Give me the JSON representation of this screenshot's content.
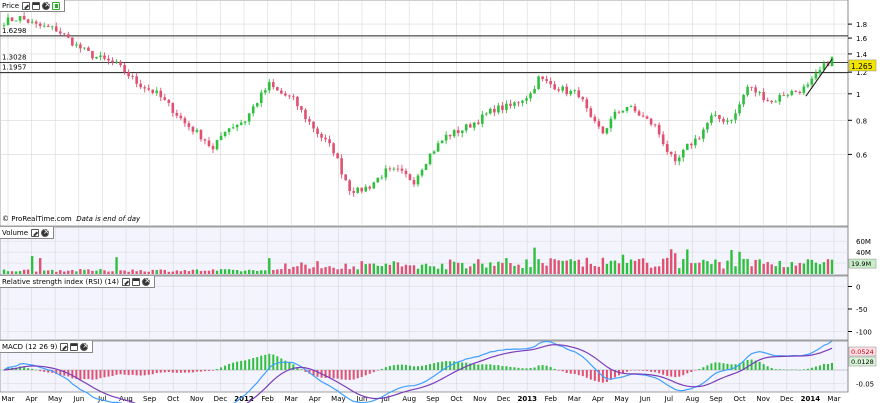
{
  "app": {
    "watermark": "© ProRealTime.com",
    "data_note": "Data is end of day"
  },
  "panels": {
    "price": {
      "title": "Price"
    },
    "volume": {
      "title": "Volume"
    },
    "rsi": {
      "title": "Relative strength index (RSI) (14)"
    },
    "macd": {
      "title": "MACD (12 26 9)"
    }
  },
  "icons": [
    "wrench-icon",
    "window-icon",
    "close-icon",
    "pin-icon"
  ],
  "colors": {
    "up": "#2fbf3f",
    "down": "#e05070",
    "grid": "#d8d8d8",
    "panel_bg": "#f4f4ff",
    "badge": "#f2e600",
    "macd_line": "#40a0ff",
    "signal_line": "#7a3db8",
    "rsi_line": "#2040c0"
  },
  "chart_data": {
    "type": "candlestick",
    "x_ticks": [
      "Mar",
      "Apr",
      "May",
      "Jun",
      "Jul",
      "Aug",
      "Sep",
      "Oct",
      "Nov",
      "Dec",
      "2012",
      "Feb",
      "Mar",
      "Apr",
      "May",
      "Jun",
      "Jul",
      "Aug",
      "Sep",
      "Oct",
      "Nov",
      "Dec",
      "2013",
      "Feb",
      "Mar",
      "Apr",
      "May",
      "Jun",
      "Jul",
      "Aug",
      "Sep",
      "Oct",
      "Nov",
      "Dec",
      "2014",
      "Mar"
    ],
    "price": {
      "y_ticks": [
        "1.8",
        "1.6",
        "1.4",
        "1.2",
        "1",
        "0.8",
        "0.6"
      ],
      "y_tick_values": [
        1.8,
        1.6,
        1.4,
        1.2,
        1.0,
        0.8,
        0.6
      ],
      "ylim": [
        0.36,
        1.96
      ],
      "horizontal_lines": [
        {
          "label": "1.6298",
          "value": 1.6298
        },
        {
          "label": "1.3028",
          "value": 1.3028
        },
        {
          "label": "1.1957",
          "value": 1.1957
        }
      ],
      "last_value": "1.265",
      "last_value_num": 1.265,
      "waypoints": [
        [
          0,
          1.84
        ],
        [
          4,
          1.9
        ],
        [
          8,
          1.78
        ],
        [
          13,
          1.72
        ],
        [
          18,
          1.5
        ],
        [
          22,
          1.38
        ],
        [
          28,
          1.28
        ],
        [
          33,
          1.1
        ],
        [
          38,
          1.0
        ],
        [
          45,
          0.78
        ],
        [
          50,
          0.68
        ],
        [
          52,
          0.62
        ],
        [
          55,
          0.74
        ],
        [
          60,
          0.8
        ],
        [
          66,
          1.08
        ],
        [
          68,
          1.02
        ],
        [
          72,
          0.95
        ],
        [
          75,
          0.82
        ],
        [
          78,
          0.72
        ],
        [
          82,
          0.62
        ],
        [
          84,
          0.52
        ],
        [
          86,
          0.45
        ],
        [
          88,
          0.44
        ],
        [
          91,
          0.46
        ],
        [
          95,
          0.52
        ],
        [
          98,
          0.52
        ],
        [
          102,
          0.48
        ],
        [
          106,
          0.6
        ],
        [
          110,
          0.7
        ],
        [
          114,
          0.74
        ],
        [
          118,
          0.8
        ],
        [
          122,
          0.88
        ],
        [
          126,
          0.9
        ],
        [
          131,
          1.0
        ],
        [
          133,
          1.14
        ],
        [
          135,
          1.1
        ],
        [
          140,
          1.02
        ],
        [
          143,
          1.0
        ],
        [
          146,
          0.8
        ],
        [
          149,
          0.72
        ],
        [
          152,
          0.84
        ],
        [
          155,
          0.9
        ],
        [
          158,
          0.84
        ],
        [
          162,
          0.76
        ],
        [
          165,
          0.62
        ],
        [
          167,
          0.55
        ],
        [
          170,
          0.64
        ],
        [
          173,
          0.7
        ],
        [
          176,
          0.82
        ],
        [
          180,
          0.8
        ],
        [
          182,
          0.84
        ],
        [
          185,
          1.06
        ],
        [
          188,
          1.0
        ],
        [
          191,
          0.93
        ],
        [
          194,
          1.0
        ],
        [
          197,
          1.02
        ],
        [
          200,
          1.06
        ],
        [
          202,
          1.16
        ],
        [
          204,
          1.26
        ],
        [
          206,
          1.34
        ]
      ]
    },
    "volume": {
      "y_ticks": [
        "60M",
        "40M",
        "20M"
      ],
      "y_tick_values": [
        60,
        40,
        20
      ],
      "ylim": [
        0,
        75
      ],
      "last_value": "19.9M"
    },
    "rsi": {
      "y_ticks": [
        "0",
        "-50",
        "-100"
      ],
      "y_tick_values": [
        0,
        -50,
        -100
      ],
      "ylim": [
        -110,
        10
      ]
    },
    "macd": {
      "y_ticks": [
        "-0.05"
      ],
      "y_tick_values": [
        -0.05
      ],
      "ylim": [
        -0.075,
        0.09
      ],
      "last_macd": "0.0524",
      "last_signal": "0.0128"
    }
  }
}
